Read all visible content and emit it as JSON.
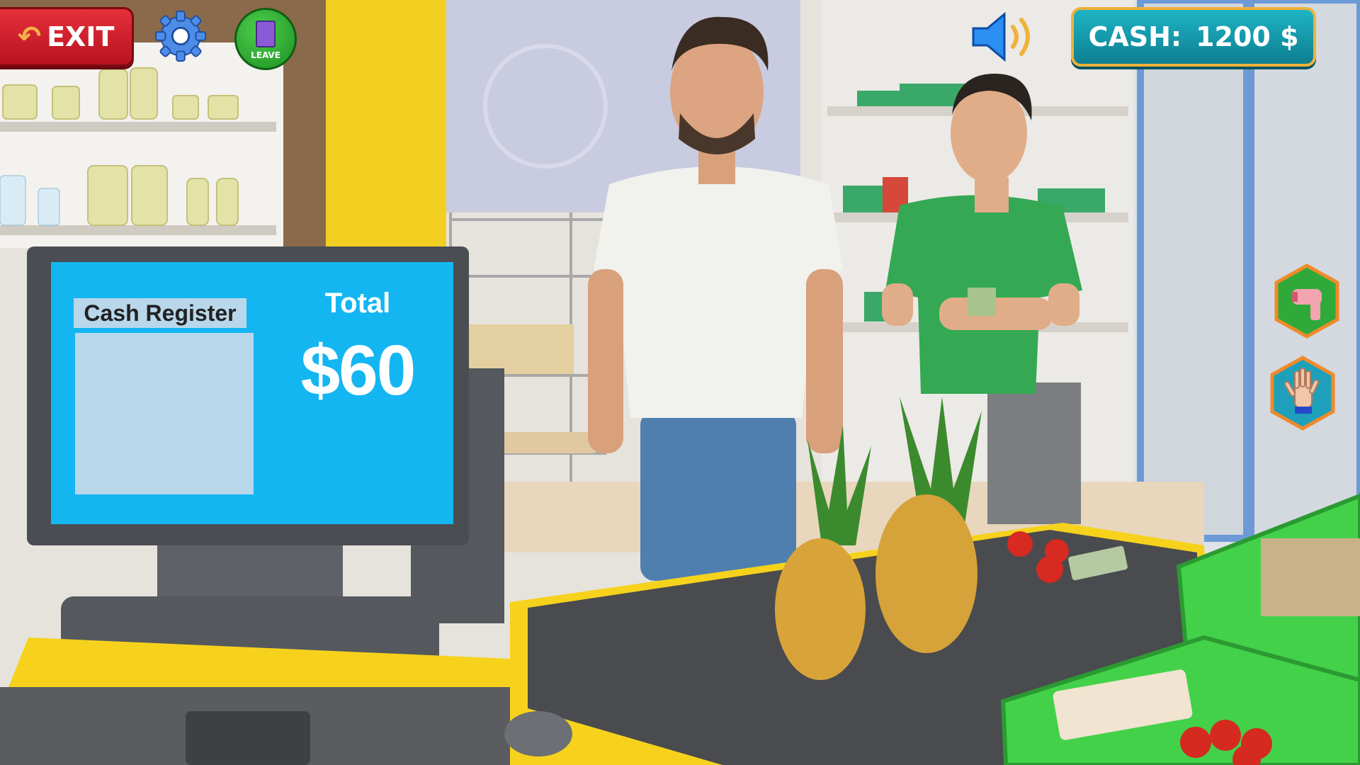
{
  "hud": {
    "exit_label": "EXIT",
    "leave_label": "LEAVE",
    "cash_label": "CASH:",
    "cash_value": "1200 $"
  },
  "register": {
    "title": "Cash Register",
    "total_label": "Total",
    "total_value": "$60"
  },
  "icons": [
    "back-arrow-icon",
    "gear-icon",
    "door-icon",
    "speaker-icon",
    "scanner-icon",
    "hand-icon"
  ],
  "colors": {
    "exit_red": "#d12230",
    "cash_teal": "#14a3b5",
    "cash_border": "#f0b23a",
    "leave_green": "#2aa82f",
    "screen_blue": "#14b6f2",
    "counter_yellow": "#f6d21c",
    "shirt_green": "#32a852"
  }
}
